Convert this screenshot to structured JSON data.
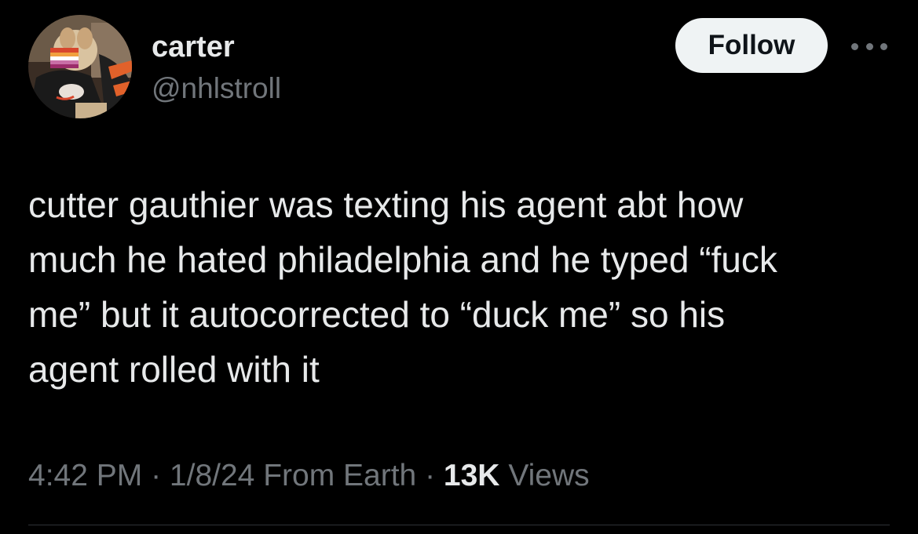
{
  "user": {
    "display_name": "carter",
    "handle": "@nhlstroll"
  },
  "actions": {
    "follow_label": "Follow",
    "more_icon": "more-horizontal-icon"
  },
  "tweet": {
    "lines": [
      "cutter gauthier was texting his agent abt how",
      "much he hated philadelphia and he typed “fuck",
      "me” but it autocorrected to “duck me” so his",
      "agent rolled with it"
    ]
  },
  "meta": {
    "time": "4:42 PM",
    "date": "1/8/24",
    "source": "From Earth",
    "separator": " · ",
    "views_count": "13K",
    "views_label": "Views"
  },
  "colors": {
    "background": "#000000",
    "primary_text": "#e7e9ea",
    "secondary_text": "#71767b",
    "follow_bg": "#eff3f4",
    "divider": "#2f3336"
  }
}
